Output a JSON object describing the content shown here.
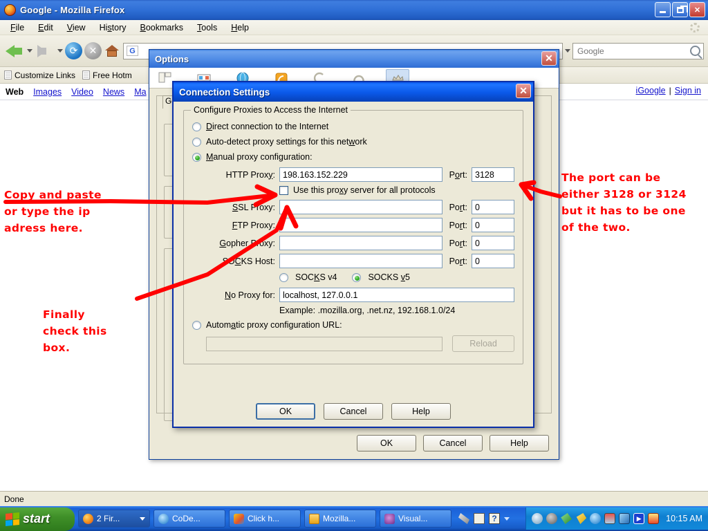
{
  "browser": {
    "title": "Google - Mozilla Firefox",
    "menus": [
      "File",
      "Edit",
      "View",
      "History",
      "Bookmarks",
      "Tools",
      "Help"
    ],
    "window_buttons": {
      "minimize": "minimize-icon",
      "maximize": "maximize-icon",
      "close": "close-icon"
    },
    "toolbar_icons": [
      "back-icon",
      "forward-icon",
      "reload-icon",
      "stop-icon",
      "home-icon"
    ],
    "url_favicon_text": "G",
    "search": {
      "placeholder": "Google",
      "value": ""
    },
    "bookmarks": [
      "Customize Links",
      "Free Hotm"
    ],
    "status": "Done"
  },
  "page": {
    "nav_links": [
      "Web",
      "Images",
      "Video",
      "News",
      "Ma"
    ],
    "current": "Web",
    "right_links": [
      "iGoogle",
      "Sign in"
    ],
    "separator": "|"
  },
  "options_dialog": {
    "title": "Options",
    "close_label": "✕",
    "tabs": [
      "Main",
      "Tabs",
      "Content",
      "Feeds",
      "Privacy",
      "Security",
      "Advanced"
    ],
    "selected_tab": "Advanced",
    "inner_tab": "Gen",
    "buttons": [
      "OK",
      "Cancel",
      "Help"
    ]
  },
  "connection_dialog": {
    "title": "Connection Settings",
    "close_label": "✕",
    "legend": "Configure Proxies to Access the Internet",
    "radios": [
      {
        "label": "Direct connection to the Internet",
        "selected": false
      },
      {
        "label": "Auto-detect proxy settings for this network",
        "selected": false
      },
      {
        "label": "Manual proxy configuration:",
        "selected": true
      }
    ],
    "proxy_rows": [
      {
        "label": "HTTP Proxy:",
        "value": "198.163.152.229",
        "port_label": "Port:",
        "port": "3128"
      },
      {
        "label": "SSL Proxy:",
        "value": "",
        "port_label": "Port:",
        "port": "0"
      },
      {
        "label": "FTP Proxy:",
        "value": "",
        "port_label": "Port:",
        "port": "0"
      },
      {
        "label": "Gopher Proxy:",
        "value": "",
        "port_label": "Port:",
        "port": "0"
      },
      {
        "label": "SOCKS Host:",
        "value": "",
        "port_label": "Port:",
        "port": "0"
      }
    ],
    "use_all_protocols": {
      "label": "Use this proxy server for all protocols",
      "checked": false
    },
    "socks_versions": [
      {
        "label": "SOCKS v4",
        "selected": false
      },
      {
        "label": "SOCKS v5",
        "selected": true
      }
    ],
    "no_proxy": {
      "label": "No Proxy for:",
      "value": "localhost, 127.0.0.1"
    },
    "example": "Example: .mozilla.org, .net.nz, 192.168.1.0/24",
    "auto_config": {
      "label": "Automatic proxy configuration URL:",
      "selected": false,
      "value": "",
      "reload_label": "Reload"
    },
    "buttons": [
      "OK",
      "Cancel",
      "Help"
    ]
  },
  "annotations": {
    "color": "#ff0000",
    "left_top": "Copy and paste\nor type the ip\nadress here.",
    "left_bottom": "Finally\ncheck this\nbox.",
    "right": "The port can be\neither 3128 or 3124\nbut it has to be one\nof the two."
  },
  "taskbar": {
    "start_label": "start",
    "items": [
      {
        "label": "2 Fir...",
        "icon": "firefox-icon",
        "has_caret": true
      },
      {
        "label": "CoDe...",
        "icon": "ie-icon",
        "has_caret": false
      },
      {
        "label": "Click h...",
        "icon": "paint-icon",
        "has_caret": false
      },
      {
        "label": "Mozilla...",
        "icon": "folder-icon",
        "has_caret": false
      },
      {
        "label": "Visual...",
        "icon": "camera-icon",
        "has_caret": false
      }
    ],
    "clock": "10:15 AM"
  }
}
